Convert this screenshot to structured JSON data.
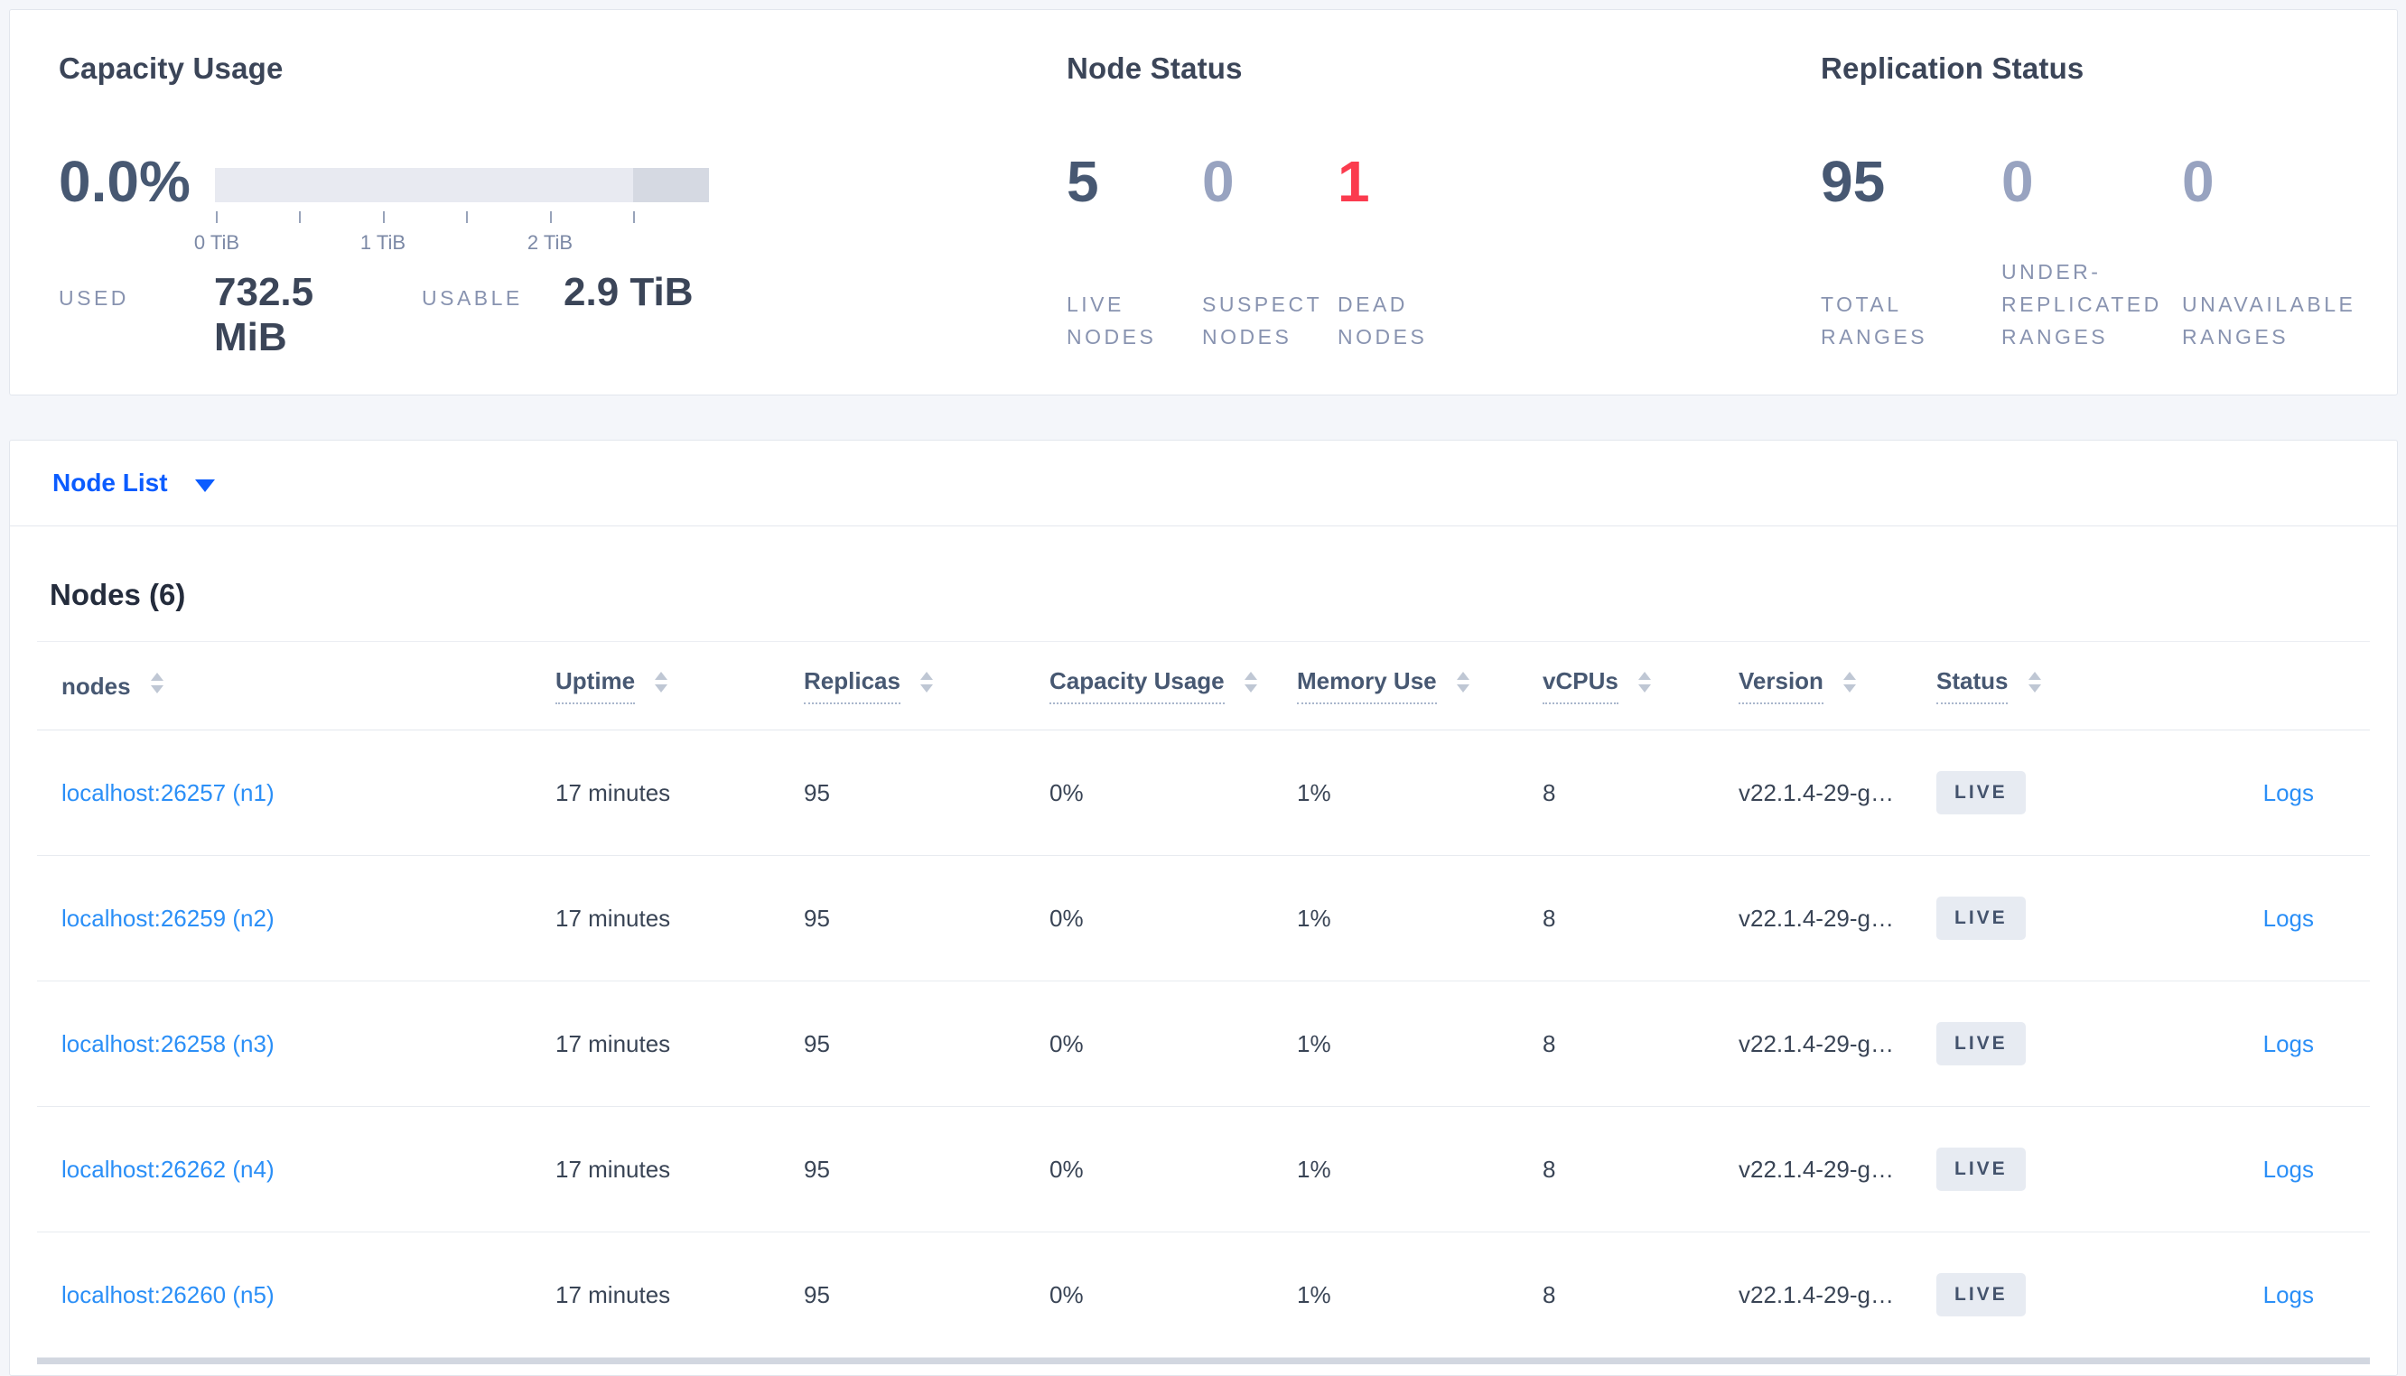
{
  "colors": {
    "page_background": "#f4f6fa",
    "card_background": "#ffffff",
    "accent_blue": "#0b5cff",
    "link_blue": "#2b8ff7",
    "number_dark": "#475872",
    "number_light": "#98a3c0",
    "number_red": "#fb3b4e",
    "label_gray": "#8893b0",
    "badge_background": "#e7ebf2",
    "bar_light": "#e8eaf1",
    "bar_dark": "#d5d9e2"
  },
  "summary": {
    "capacity": {
      "title": "Capacity Usage",
      "percent": "0.0%",
      "axis_ticks": [
        "0 TiB",
        "1 TiB",
        "2 TiB"
      ],
      "bar": {
        "tick_interval_tib": 0.5,
        "bar_total_tib": 2.9,
        "highlight_segment_start_tib": 2.5,
        "used_fraction_percent": 0.0
      },
      "stats": [
        {
          "label": "USED",
          "value": "732.5 MiB"
        },
        {
          "label": "USABLE",
          "value": "2.9 TiB"
        }
      ]
    },
    "node_status": {
      "title": "Node Status",
      "metrics": [
        {
          "value": "5",
          "label": "LIVE NODES",
          "tone": "dark"
        },
        {
          "value": "0",
          "label": "SUSPECT NODES",
          "tone": "light"
        },
        {
          "value": "1",
          "label": "DEAD NODES",
          "tone": "red"
        }
      ]
    },
    "replication": {
      "title": "Replication Status",
      "metrics": [
        {
          "value": "95",
          "label": "TOTAL RANGES",
          "tone": "dark"
        },
        {
          "value": "0",
          "label": "UNDER-REPLICATED RANGES",
          "tone": "light"
        },
        {
          "value": "0",
          "label": "UNAVAILABLE RANGES",
          "tone": "light"
        }
      ]
    }
  },
  "view_selector": {
    "label": "Node List"
  },
  "nodes_section": {
    "title": "Nodes (6)",
    "columns": [
      {
        "label": "nodes",
        "dotted": false
      },
      {
        "label": "Uptime",
        "dotted": true
      },
      {
        "label": "Replicas",
        "dotted": true
      },
      {
        "label": "Capacity Usage",
        "dotted": true
      },
      {
        "label": "Memory Use",
        "dotted": true
      },
      {
        "label": "vCPUs",
        "dotted": true
      },
      {
        "label": "Version",
        "dotted": true
      },
      {
        "label": "Status",
        "dotted": true
      }
    ],
    "rows": [
      {
        "address": "localhost:26257 (n1)",
        "uptime": "17 minutes",
        "replicas": "95",
        "capacity_usage": "0%",
        "memory_use": "1%",
        "vcpus": "8",
        "version": "v22.1.4-29-g…",
        "status": "LIVE",
        "logs": "Logs"
      },
      {
        "address": "localhost:26259 (n2)",
        "uptime": "17 minutes",
        "replicas": "95",
        "capacity_usage": "0%",
        "memory_use": "1%",
        "vcpus": "8",
        "version": "v22.1.4-29-g…",
        "status": "LIVE",
        "logs": "Logs"
      },
      {
        "address": "localhost:26258 (n3)",
        "uptime": "17 minutes",
        "replicas": "95",
        "capacity_usage": "0%",
        "memory_use": "1%",
        "vcpus": "8",
        "version": "v22.1.4-29-g…",
        "status": "LIVE",
        "logs": "Logs"
      },
      {
        "address": "localhost:26262 (n4)",
        "uptime": "17 minutes",
        "replicas": "95",
        "capacity_usage": "0%",
        "memory_use": "1%",
        "vcpus": "8",
        "version": "v22.1.4-29-g…",
        "status": "LIVE",
        "logs": "Logs"
      },
      {
        "address": "localhost:26260 (n5)",
        "uptime": "17 minutes",
        "replicas": "95",
        "capacity_usage": "0%",
        "memory_use": "1%",
        "vcpus": "8",
        "version": "v22.1.4-29-g…",
        "status": "LIVE",
        "logs": "Logs"
      }
    ]
  }
}
